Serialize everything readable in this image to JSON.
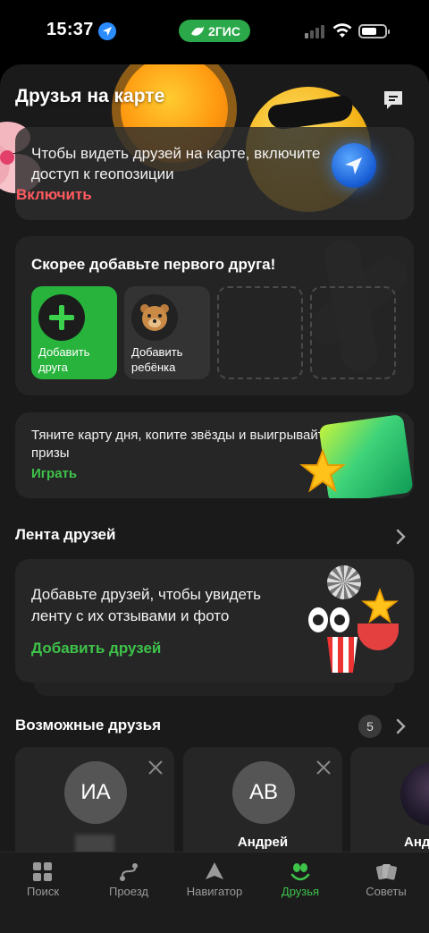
{
  "status_bar": {
    "time": "15:37",
    "app_name": "2ГИС"
  },
  "header": {
    "title": "Друзья на карте",
    "feedback_icon": "chat-bubble-icon"
  },
  "geo_card": {
    "text": "Чтобы видеть друзей на карте, включите доступ к геопозиции",
    "action": "Включить",
    "accent": "#ff5a5f"
  },
  "add_friend_card": {
    "title": "Скорее добавьте первого друга!",
    "tiles": [
      {
        "label": "Добавить друга",
        "icon": "plus-icon"
      },
      {
        "label": "Добавить ребёнка",
        "icon": "bear-icon"
      }
    ]
  },
  "game_card": {
    "text": "Тяните карту дня, копите звёзды и выигрывайте ценные призы",
    "action": "Играть"
  },
  "feed": {
    "title": "Лента друзей",
    "text": "Добавьте друзей, чтобы увидеть ленту с их отзывами и фото",
    "action": "Добавить друзей",
    "accent": "#3ec34a"
  },
  "suggestions": {
    "title": "Возможные друзья",
    "count": "5",
    "people": [
      {
        "initials": "ИА",
        "name": ""
      },
      {
        "initials": "АВ",
        "name": "Андрей"
      },
      {
        "initials": "",
        "name": "Анд"
      }
    ]
  },
  "tabs": [
    {
      "label": "Поиск",
      "icon": "grid-icon"
    },
    {
      "label": "Проезд",
      "icon": "route-icon"
    },
    {
      "label": "Навигатор",
      "icon": "navigator-icon"
    },
    {
      "label": "Друзья",
      "icon": "friends-icon",
      "active": true
    },
    {
      "label": "Советы",
      "icon": "cards-icon"
    }
  ]
}
